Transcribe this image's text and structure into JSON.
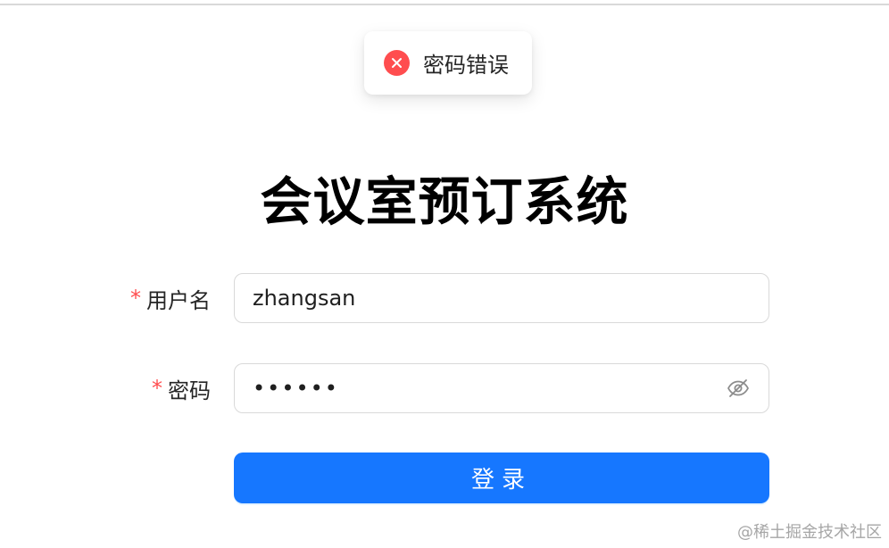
{
  "toast": {
    "message": "密码错误",
    "type": "error",
    "icon": "close-circle-icon",
    "color": "#ff4d4f"
  },
  "page": {
    "title": "会议室预订系统"
  },
  "form": {
    "username": {
      "required_mark": "*",
      "label": "用户名",
      "value": "zhangsan"
    },
    "password": {
      "required_mark": "*",
      "label": "密码",
      "value": "••••••",
      "toggle_icon": "eye-invisible-icon"
    },
    "submit_label": "登录"
  },
  "watermark": {
    "text": "@稀土掘金技术社区"
  },
  "colors": {
    "primary": "#1677ff",
    "error": "#ff4d4f",
    "border": "#d9d9d9"
  }
}
